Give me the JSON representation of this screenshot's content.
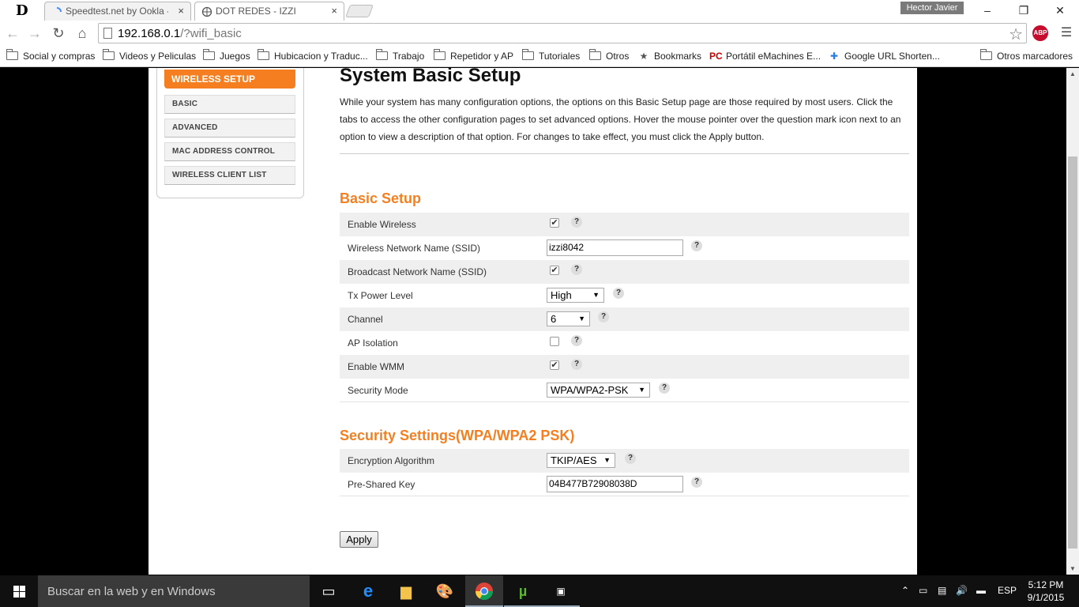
{
  "browser": {
    "tabs": [
      {
        "title": "Speedtest.net by Ookla - ",
        "close": "×"
      },
      {
        "title": "DOT REDES - IZZI",
        "close": "×"
      }
    ],
    "profile_name": "Hector Javier",
    "window_controls": {
      "minimize": "–",
      "restore": "❐",
      "close": "✕"
    },
    "url_host": "192.168.0.1",
    "url_path": "/?wifi_basic",
    "abp_label": "ABP",
    "bookmarks": [
      {
        "label": "Social y compras",
        "icon": "folder-icon"
      },
      {
        "label": "Videos y Peliculas",
        "icon": "folder-icon"
      },
      {
        "label": "Juegos",
        "icon": "folder-icon"
      },
      {
        "label": "Hubicacion y Traduc...",
        "icon": "folder-icon"
      },
      {
        "label": "Trabajo",
        "icon": "folder-icon"
      },
      {
        "label": "Repetidor y AP",
        "icon": "folder-icon"
      },
      {
        "label": "Tutoriales",
        "icon": "folder-icon"
      },
      {
        "label": "Otros",
        "icon": "folder-icon"
      },
      {
        "label": "Bookmarks",
        "icon": "star-icon"
      },
      {
        "label": "Portátil eMachines E...",
        "icon": "pc-icon",
        "icon_text": "PC"
      },
      {
        "label": "Google URL Shorten...",
        "icon": "puzzle-icon"
      }
    ],
    "other_bookmarks": "Otros marcadores"
  },
  "sidebar": {
    "header": "WIRELESS SETUP",
    "items": [
      "BASIC",
      "ADVANCED",
      "MAC ADDRESS CONTROL",
      "WIRELESS CLIENT LIST"
    ]
  },
  "content": {
    "title": "System Basic Setup",
    "intro": "While your system has many configuration options, the options on this Basic Setup page are those required by most users. Click the tabs to access the other configuration pages to set advanced options. Hover the mouse pointer over the question mark icon next to an option to view a description of that option. For changes to take effect, you must click the Apply button.",
    "help_glyph": "?",
    "check_glyph": "✔",
    "caret_glyph": "▼",
    "basic_setup": {
      "title": "Basic Setup",
      "enable_wireless": {
        "label": "Enable Wireless",
        "checked": true
      },
      "ssid": {
        "label": "Wireless Network Name (SSID)",
        "value": "izzi8042"
      },
      "broadcast_ssid": {
        "label": "Broadcast Network Name (SSID)",
        "checked": true
      },
      "tx_power": {
        "label": "Tx Power Level",
        "value": "High"
      },
      "channel": {
        "label": "Channel",
        "value": "6"
      },
      "ap_isolation": {
        "label": "AP Isolation",
        "checked": false
      },
      "enable_wmm": {
        "label": "Enable WMM",
        "checked": true
      },
      "security_mode": {
        "label": "Security Mode",
        "value": "WPA/WPA2-PSK"
      }
    },
    "security": {
      "title": "Security Settings(WPA/WPA2 PSK)",
      "encryption": {
        "label": "Encryption Algorithm",
        "value": "TKIP/AES"
      },
      "psk": {
        "label": "Pre-Shared Key",
        "value": "04B477B72908038D"
      }
    },
    "apply_label": "Apply"
  },
  "taskbar": {
    "search_placeholder": "Buscar en la web y en Windows",
    "language": "ESP",
    "time": "5:12 PM",
    "date": "9/1/2015"
  }
}
